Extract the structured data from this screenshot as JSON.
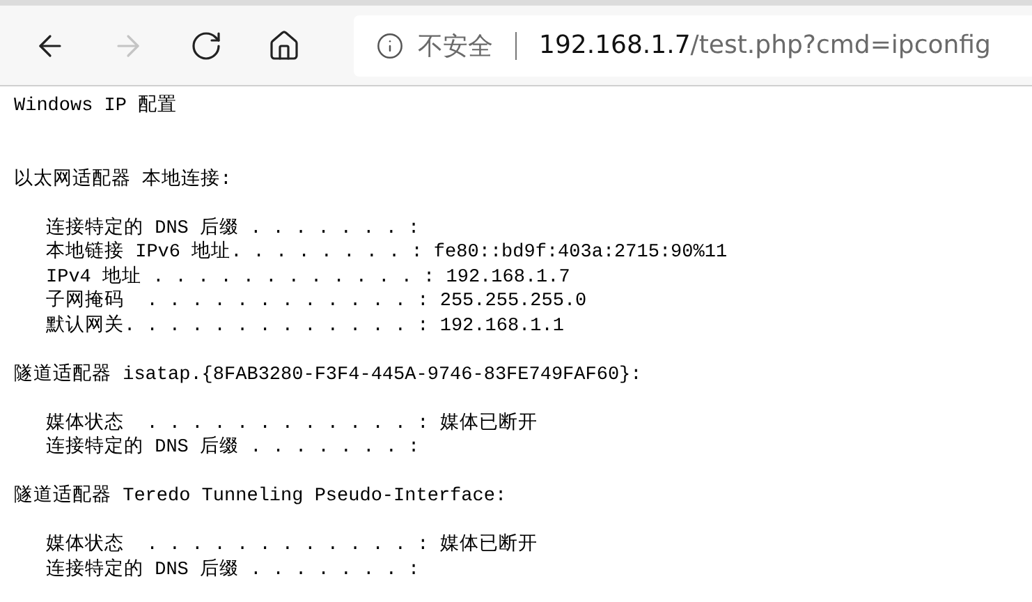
{
  "toolbar": {
    "buttons": [
      {
        "kind": "back",
        "disabled": false
      },
      {
        "kind": "forward",
        "disabled": true
      },
      {
        "kind": "refresh",
        "disabled": false
      },
      {
        "kind": "home",
        "disabled": false
      }
    ],
    "address": {
      "security": "不安全",
      "host": "192.168.1.7",
      "path": "/test.php?cmd=ipconfig"
    }
  },
  "output": {
    "title": "Windows IP 配置",
    "sections": [
      {
        "heading": "以太网适配器 本地连接:",
        "lines": [
          "连接特定的 DNS 后缀 . . . . . . . :",
          "本地链接 IPv6 地址. . . . . . . . : fe80::bd9f:403a:2715:90%11",
          "IPv4 地址 . . . . . . . . . . . . : 192.168.1.7",
          "子网掩码  . . . . . . . . . . . . : 255.255.255.0",
          "默认网关. . . . . . . . . . . . . : 192.168.1.1"
        ]
      },
      {
        "heading": "隧道适配器 isatap.{8FAB3280-F3F4-445A-9746-83FE749FAF60}:",
        "lines": [
          "媒体状态  . . . . . . . . . . . . : 媒体已断开",
          "连接特定的 DNS 后缀 . . . . . . . :"
        ]
      },
      {
        "heading": "隧道适配器 Teredo Tunneling Pseudo-Interface:",
        "lines": [
          "媒体状态  . . . . . . . . . . . . : 媒体已断开",
          "连接特定的 DNS 后缀 . . . . . . . :"
        ]
      }
    ]
  }
}
